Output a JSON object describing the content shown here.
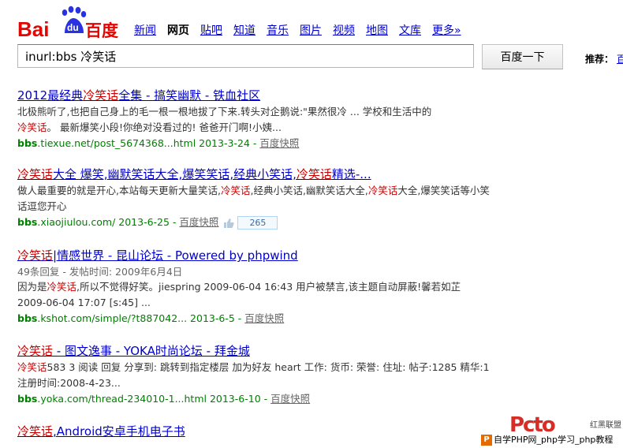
{
  "logo": {
    "text_bai": "Bai",
    "text_du": "du",
    "text_cn": "百度"
  },
  "nav": [
    {
      "label": "新闻",
      "active": false
    },
    {
      "label": "网页",
      "active": true
    },
    {
      "label": "贴吧",
      "active": false
    },
    {
      "label": "知道",
      "active": false
    },
    {
      "label": "音乐",
      "active": false
    },
    {
      "label": "图片",
      "active": false
    },
    {
      "label": "视频",
      "active": false
    },
    {
      "label": "地图",
      "active": false
    },
    {
      "label": "文库",
      "active": false
    },
    {
      "label": "更多»",
      "active": false
    }
  ],
  "search": {
    "query": "inurl:bbs 冷笑话",
    "button_label": "百度一下"
  },
  "recommend": {
    "label": "推荐：",
    "link": "百"
  },
  "results": [
    {
      "title_pre": "2012最经典",
      "title_em": "冷笑话",
      "title_post": "全集 - 搞笑幽默 - 铁血社区",
      "abs_1": "北极熊听了,也把自己身上的毛一根一根地拔了下来.转头对企鹅说:\"果然很冷 ... 学校和生活中的",
      "abs_em": "冷笑话",
      "abs_2": "。 最新爆笑小段!你绝对没看过的! 爸爸开门啊!小姨...",
      "url_domain": "bbs",
      "url_rest": ".tiexue.net/post_5674368...html 2013-3-24 - ",
      "cache": "百度快照"
    },
    {
      "title_pre": "",
      "title_em": "冷笑话",
      "title_post": "大全 爆笑,幽默笑话大全,爆笑笑话,经典小笑话,",
      "title_em2": "冷笑话",
      "title_post2": "精选-...",
      "abs_1": "做人最重要的就是开心,本站每天更新大量笑话,",
      "abs_em": "冷笑话",
      "abs_2": ",经典小笑话,幽默笑话大全,",
      "abs_em2": "冷笑话",
      "abs_3": "大全,爆笑笑话等小笑话逗您开心",
      "url_domain": "bbs",
      "url_rest": ".xiaojiulou.com/ 2013-6-25 - ",
      "cache": "百度快照",
      "like_count": "265"
    },
    {
      "title_pre": "",
      "title_em": "冷笑话",
      "title_post": "|情感世界 - 昆山论坛 - Powered by phpwind",
      "meta": "49条回复 - 发帖时间: 2009年6月4日",
      "abs_1": "因为是",
      "abs_em": "冷笑话",
      "abs_2": ",所以不觉得好笑。jiespring 2009-06-04 16:43 用户被禁言,该主题自动屏蔽!馨若如芷 2009-06-04 17:07 [s:45] ...",
      "url_domain": "bbs",
      "url_rest": ".kshot.com/simple/?t887042... 2013-6-5 - ",
      "cache": "百度快照"
    },
    {
      "title_pre": "",
      "title_em": "冷笑话",
      "title_post": " - 图文逸事 - YOKA时尚论坛 - 拜金城",
      "abs_1": "",
      "abs_em": "冷笑话",
      "abs_2": "583 3 阅读 回复 分享到: 跳转到指定楼层 加为好友 heart 工作: 货币: 荣誉: 住址: 帖子:1285 精华:1注册时间:2008-4-23...",
      "url_domain": "bbs",
      "url_rest": ".yoka.com/thread-234010-1...html 2013-6-10 - ",
      "cache": "百度快照"
    },
    {
      "title_pre": "",
      "title_em": "冷笑话",
      "title_post": ",Android安卓手机电子书"
    }
  ],
  "watermark": {
    "logo": "Pcto",
    "tag": "红黑联盟",
    "bar": "自学PHP网_php学习_php教程"
  }
}
